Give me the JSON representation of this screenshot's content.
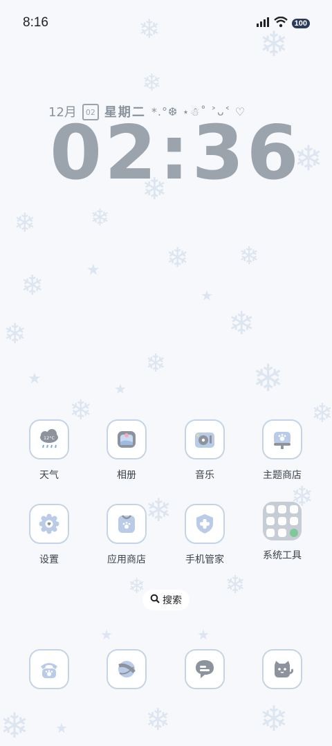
{
  "status_bar": {
    "time": "8:16",
    "battery": "100",
    "icons": [
      "signal-icon",
      "wifi-icon",
      "battery-icon"
    ]
  },
  "lockscreen": {
    "month": "12月",
    "calendar_day": "02",
    "weekday": "星期二",
    "decoration": "*.°❆ ⋆☃˚ ˃ᴗ˂ ♡",
    "clock": "02:36"
  },
  "apps": [
    {
      "label": "天气",
      "icon": "weather-icon",
      "temp": "12°C"
    },
    {
      "label": "相册",
      "icon": "gallery-icon"
    },
    {
      "label": "音乐",
      "icon": "music-icon"
    },
    {
      "label": "主题商店",
      "icon": "theme-store-icon"
    },
    {
      "label": "设置",
      "icon": "settings-icon"
    },
    {
      "label": "应用商店",
      "icon": "app-store-icon"
    },
    {
      "label": "手机管家",
      "icon": "phone-manager-icon"
    },
    {
      "label": "系统工具",
      "icon": "system-tools-folder-icon"
    }
  ],
  "search": {
    "label": "搜索"
  },
  "dock": [
    {
      "icon": "phone-icon"
    },
    {
      "icon": "browser-icon"
    },
    {
      "icon": "messages-icon"
    },
    {
      "icon": "camera-cat-icon"
    }
  ],
  "colors": {
    "background": "#f6f8fb",
    "icon_border": "#c6d3e6",
    "icon_fill": "#b9cbe6",
    "clock": "#9ba3ad"
  }
}
